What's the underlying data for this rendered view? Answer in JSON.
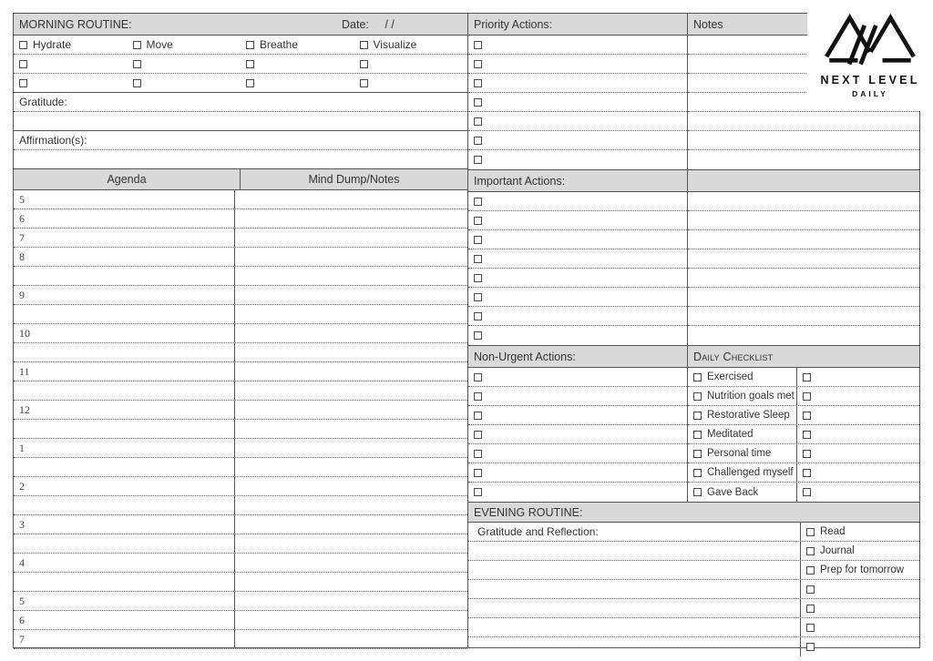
{
  "brand": {
    "mark": "mountain-triangles-logo",
    "name": "NEXT LEVEL",
    "sub": "DAILY"
  },
  "morning": {
    "title": "MORNING ROUTINE:",
    "date_label": "Date:",
    "date_value": "/     /",
    "habits": [
      "Hydrate",
      "Move",
      "Breathe",
      "Visualize"
    ],
    "habit_blank_rows": 2,
    "gratitude_label": "Gratitude:",
    "affirmation_label": "Affirmation(s):"
  },
  "agenda": {
    "col1_header": "Agenda",
    "col2_header": "Mind Dump/Notes",
    "rows": [
      {
        "hour": "5"
      },
      {
        "hour": "6"
      },
      {
        "hour": "7"
      },
      {
        "hour": "8"
      },
      {
        "hour": ""
      },
      {
        "hour": "9"
      },
      {
        "hour": ""
      },
      {
        "hour": "10"
      },
      {
        "hour": ""
      },
      {
        "hour": "11"
      },
      {
        "hour": ""
      },
      {
        "hour": "12"
      },
      {
        "hour": ""
      },
      {
        "hour": "1"
      },
      {
        "hour": ""
      },
      {
        "hour": "2"
      },
      {
        "hour": ""
      },
      {
        "hour": "3"
      },
      {
        "hour": ""
      },
      {
        "hour": "4"
      },
      {
        "hour": ""
      },
      {
        "hour": "5"
      },
      {
        "hour": "6"
      },
      {
        "hour": "7"
      }
    ]
  },
  "priority": {
    "title": "Priority Actions:",
    "row_count": 7
  },
  "notes": {
    "title": "Notes",
    "row_count": 8
  },
  "important": {
    "title": "Important Actions:",
    "row_count": 8
  },
  "nonurgent": {
    "title": "Non-Urgent Actions:",
    "row_count": 7
  },
  "checklist": {
    "title": "Daily Checklist",
    "items": [
      "Exercised",
      "Nutrition goals met",
      "Restorative Sleep",
      "Meditated",
      "Personal time",
      "Challenged myself",
      "Gave Back"
    ]
  },
  "evening": {
    "title": "EVENING ROUTINE:",
    "gratitude_label": "Gratitude and Reflection:",
    "items": [
      "Read",
      "Journal",
      "Prep for tomorrow",
      "",
      "",
      "",
      ""
    ],
    "blank_rows": 6
  },
  "colors": {
    "header_gray": "#d9d9d9",
    "rule": "#555555",
    "dotted": "#666666",
    "text": "#333333",
    "logo": "#111111"
  }
}
